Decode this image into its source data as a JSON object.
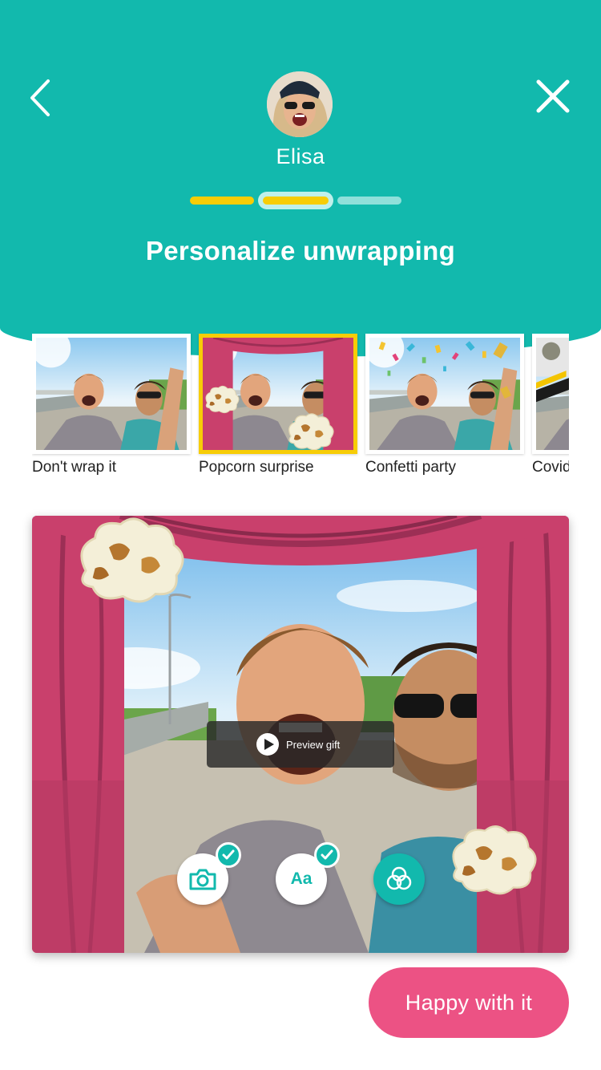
{
  "header": {
    "back_icon": "chevron-left-icon",
    "close_icon": "close-icon",
    "recipient_name": "Elisa",
    "title": "Personalize unwrapping",
    "colors": {
      "header_bg": "#12b9ad",
      "progress_active": "#f7cd06",
      "progress_inactive": "#8fe0da"
    }
  },
  "progress": {
    "total_steps": 3,
    "current_step": 2,
    "completed_steps": 1
  },
  "wrapping_styles": [
    {
      "label": "Don't wrap it",
      "selected": false
    },
    {
      "label": "Popcorn surprise",
      "selected": true
    },
    {
      "label": "Confetti party",
      "selected": false
    },
    {
      "label": "Covid",
      "selected": false
    }
  ],
  "preview": {
    "preview_gift_label": "Preview gift",
    "tools": [
      {
        "icon": "camera-icon",
        "checked": true
      },
      {
        "label": "Aa",
        "icon": "text-icon",
        "checked": true
      },
      {
        "icon": "filter-circles-icon",
        "checked": false
      }
    ]
  },
  "actions": {
    "happy_label": "Happy with it",
    "happy_color": "#ec5284"
  }
}
